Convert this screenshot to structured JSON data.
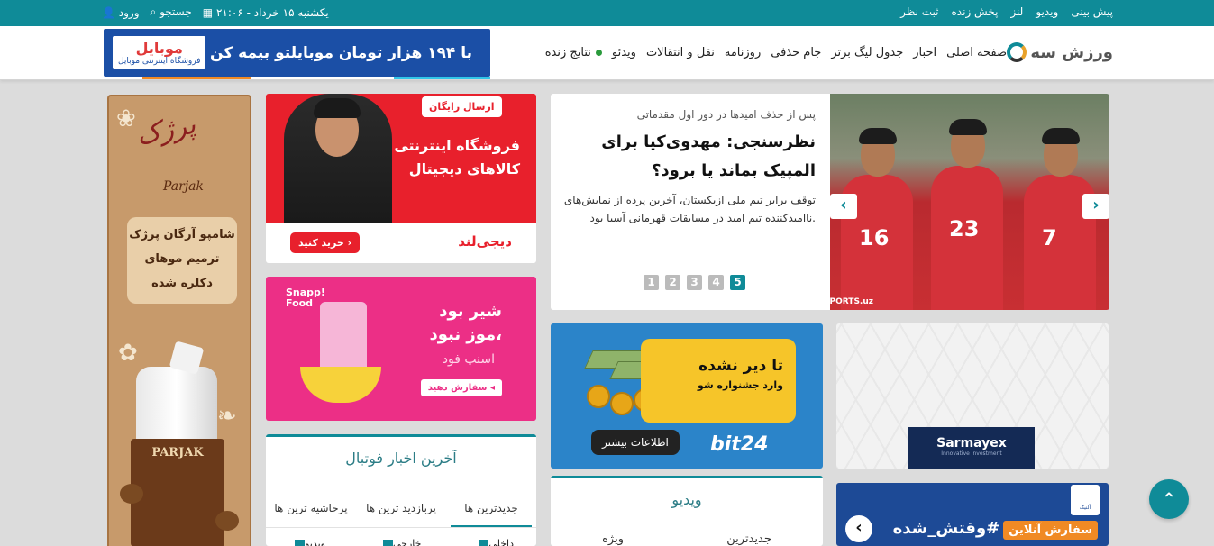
{
  "topbar": {
    "links": [
      "پیش بینی",
      "ویدیو",
      "لنز",
      "پخش زنده",
      "ثبت نظر"
    ],
    "date": "یکشنبه ۱۵ خرداد - ۲۱:۰۶",
    "search": "جستجو",
    "login": "ورود"
  },
  "header": {
    "logo": "ورزش سه",
    "menu": [
      "صفحه اصلی",
      "اخبار",
      "جدول لیگ برتر",
      "جام حذفی",
      "روزنامه",
      "نقل و انتقالات",
      "ویدئو",
      "نتایج زنده"
    ],
    "top_ad": {
      "text": "با ۱۹۴ هزار تومان موبایلتو بیمه کن",
      "brand": "موبایل",
      "brand_sub": "فروشگاه اینترنتی موبایل"
    }
  },
  "ads": {
    "parjak": {
      "script": "پرژک",
      "eng": "Parjak",
      "lines": [
        "شامپو آرگان پرژک",
        "ترمیم موهای",
        "دکلره شده"
      ],
      "bottle_label": "PARJAK"
    },
    "digikala": {
      "free": "ارسال رایگان",
      "line1": "فروشگاه اینترنتی",
      "line2": "کالاهای دیجیتال",
      "buy": "خرید کنید ›",
      "brand": "دیجی‌لند"
    },
    "snappfood": {
      "logo_line1": "Snapp!",
      "logo_line2": "Food",
      "line1": "شیر بود",
      "line2": "موز نبود،",
      "sub": "اسنپ فود",
      "btn": "سفارش دهید ◂"
    },
    "bit24": {
      "line1": "تا دیر نشده",
      "line2": "وارد جشنواره شو",
      "more": "اطلاعات بیشتر",
      "brand": "bit24"
    },
    "sarmayex": {
      "brand": "Sarmayex",
      "sub": "Innovative Investment"
    },
    "vaghtesh": {
      "text": "#وقتش_شده",
      "badge": "سفارش آنلاین",
      "logo": "آلنیک"
    }
  },
  "hero": {
    "kicker": "پس از حذف امیدها در دور اول مقدماتی",
    "headline": "نظرسنجی: مهدوی‌کیا برای المپیک بماند یا برود؟",
    "lead": "توقف برابر تیم ملی ازبکستان، آخرین پرده از نمایش‌های ناامیدکننده تیم امید در مسابقات قهرمانی آسیا بود.",
    "credit": "SPORTS.uz",
    "player_numbers": [
      "16",
      "23",
      "7"
    ],
    "pages": [
      "1",
      "2",
      "3",
      "4",
      "5"
    ],
    "active_page": "5"
  },
  "news": {
    "title": "آخرین اخبار فوتبال",
    "tabs": [
      "جدیدترین ها",
      "پربازدید ترین ها",
      "پرحاشیه ترین ها"
    ],
    "filters": [
      "داخلی",
      "خارجی",
      "ویدیو"
    ]
  },
  "video": {
    "title": "ویدیو",
    "tabs": [
      "جدیدترین",
      "ویژه"
    ]
  },
  "colors": {
    "accent": "#0f8b98",
    "brand_red": "#e8202c",
    "snapp_pink": "#ec2f86"
  },
  "icons": {
    "totop": "chevron-up-icon",
    "calendar": "calendar-icon",
    "search": "search-icon",
    "user": "user-icon"
  }
}
